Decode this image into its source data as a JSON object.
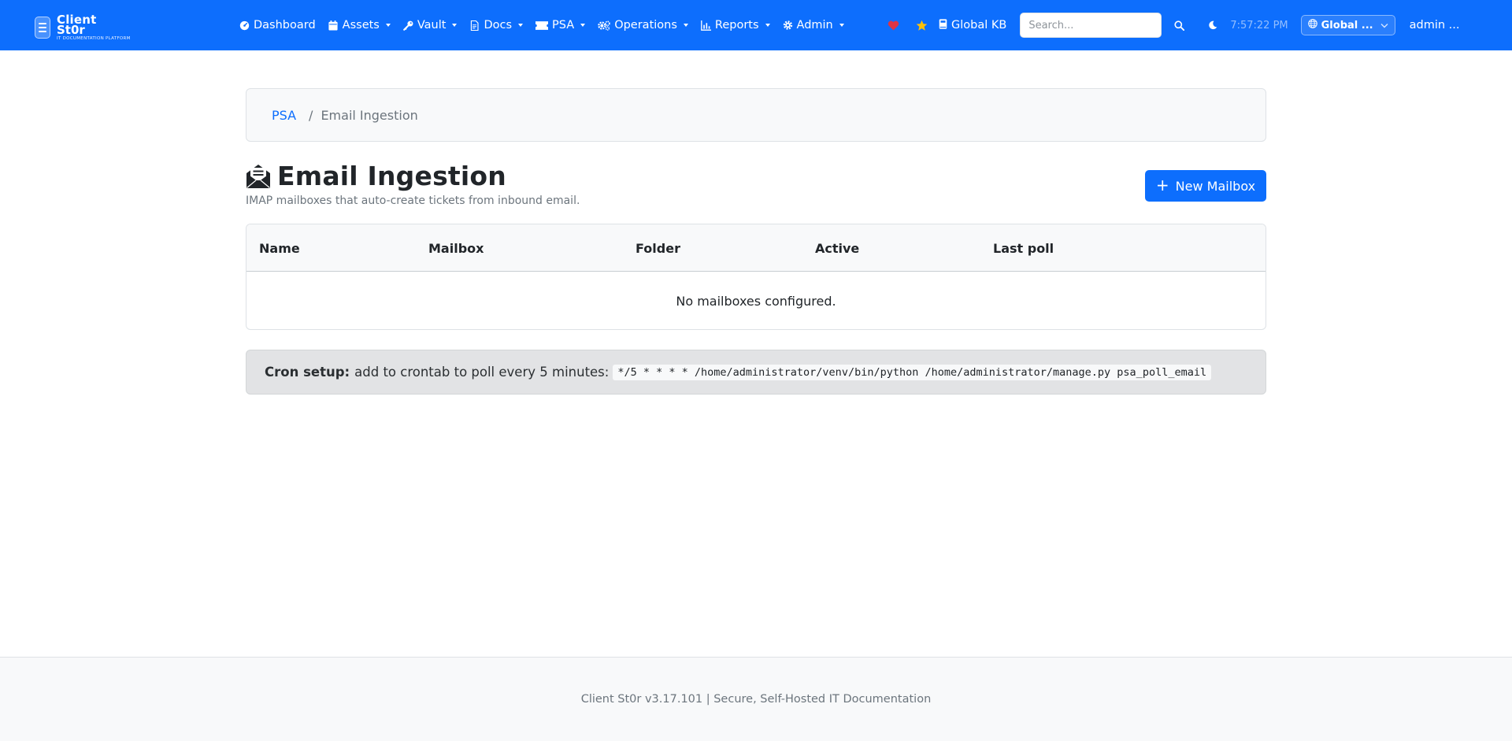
{
  "brand": {
    "name_line1": "Client",
    "name_line2": "St0r",
    "tagline": "IT DOCUMENTATION PLATFORM"
  },
  "nav": {
    "items": [
      {
        "label": "Dashboard",
        "icon": "dashboard-icon",
        "dropdown": false
      },
      {
        "label": "Assets",
        "icon": "calendar-icon",
        "dropdown": true
      },
      {
        "label": "Vault",
        "icon": "key-icon",
        "dropdown": true
      },
      {
        "label": "Docs",
        "icon": "document-icon",
        "dropdown": true
      },
      {
        "label": "PSA",
        "icon": "ticket-icon",
        "dropdown": true
      },
      {
        "label": "Operations",
        "icon": "gears-icon",
        "dropdown": true
      },
      {
        "label": "Reports",
        "icon": "chart-icon",
        "dropdown": true
      },
      {
        "label": "Admin",
        "icon": "gear-icon",
        "dropdown": true
      }
    ],
    "global_kb_label": "Global KB",
    "search_placeholder": "Search...",
    "clock": "7:57:22 PM",
    "scope_label": "Global ...",
    "user_label": "admin ..."
  },
  "colors": {
    "brand": "#0d6efd",
    "heart": "#dc3545",
    "star": "#ffc107"
  },
  "breadcrumb": {
    "parent": "PSA",
    "separator": "/",
    "current": "Email Ingestion"
  },
  "header": {
    "title": "Email Ingestion",
    "subtitle": "IMAP mailboxes that auto-create tickets from inbound email.",
    "new_button_label": "New Mailbox",
    "new_button_icon": "+"
  },
  "table": {
    "columns": [
      "Name",
      "Mailbox",
      "Folder",
      "Active",
      "Last poll"
    ],
    "empty_message": "No mailboxes configured."
  },
  "cron": {
    "label": "Cron setup:",
    "text": "add to crontab to poll every 5 minutes:",
    "command": "*/5 * * * * /home/administrator/venv/bin/python /home/administrator/manage.py psa_poll_email"
  },
  "footer": {
    "text": "Client St0r v3.17.101 | Secure, Self-Hosted IT Documentation"
  }
}
